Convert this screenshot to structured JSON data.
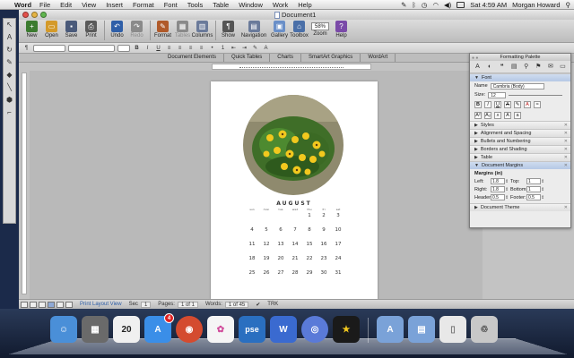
{
  "menubar": {
    "app": "Word",
    "items": [
      "File",
      "Edit",
      "View",
      "Insert",
      "Format",
      "Font",
      "Tools",
      "Table",
      "Window",
      "Work",
      "Help"
    ],
    "clock": "Sat 4:59 AM",
    "user": "Morgan Howard"
  },
  "window": {
    "title": "Document1"
  },
  "toolbar": {
    "buttons": [
      {
        "label": "New",
        "icon": "new-document-icon",
        "color": "#3b7b2f"
      },
      {
        "label": "Open",
        "icon": "open-folder-icon",
        "color": "#d49a2a"
      },
      {
        "label": "Save",
        "icon": "save-disk-icon",
        "color": "#4a5a7a"
      },
      {
        "label": "Print",
        "icon": "printer-icon",
        "color": "#5a5a5a"
      },
      {
        "label": "Undo",
        "icon": "undo-icon",
        "color": "#2f5fa8"
      },
      {
        "label": "Redo",
        "icon": "redo-icon",
        "color": "#8a8a8a"
      },
      {
        "label": "Format",
        "icon": "format-brush-icon",
        "color": "#b05a2a"
      },
      {
        "label": "Tables",
        "icon": "table-icon",
        "color": "#8a8a8a"
      },
      {
        "label": "Columns",
        "icon": "columns-icon",
        "color": "#6a7a9a"
      },
      {
        "label": "Show",
        "icon": "pilcrow-icon",
        "color": "#555555"
      },
      {
        "label": "Navigation",
        "icon": "navigation-pane-icon",
        "color": "#6a7a9a"
      },
      {
        "label": "Gallery",
        "icon": "gallery-icon",
        "color": "#6a8fc8"
      },
      {
        "label": "Toolbox",
        "icon": "toolbox-icon",
        "color": "#4a6fa8"
      },
      {
        "label": "Zoom",
        "icon": "zoom-field",
        "color": "#ffffff"
      },
      {
        "label": "Help",
        "icon": "help-icon",
        "color": "#7a4aa8"
      }
    ],
    "zoom": "58%"
  },
  "ribbon": {
    "tabs": [
      "Document Elements",
      "Quick Tables",
      "Charts",
      "SmartArt Graphics",
      "WordArt"
    ]
  },
  "document": {
    "month": "AUGUST",
    "weekday_headers": [
      "sun",
      "mon",
      "tue",
      "wed",
      "thu",
      "fri",
      "sat"
    ],
    "weeks": [
      [
        "",
        "",
        "",
        "",
        "1",
        "2",
        "3"
      ],
      [
        "4",
        "5",
        "6",
        "7",
        "8",
        "9",
        "10"
      ],
      [
        "11",
        "12",
        "13",
        "14",
        "15",
        "16",
        "17"
      ],
      [
        "18",
        "19",
        "20",
        "21",
        "22",
        "23",
        "24"
      ],
      [
        "25",
        "26",
        "27",
        "28",
        "29",
        "30",
        "31"
      ]
    ],
    "photo_description": "yellow flowers"
  },
  "status": {
    "view": "Print Layout View",
    "sec_label": "Sec",
    "sec": "1",
    "pages_label": "Pages:",
    "pages": "1 of 1",
    "words_label": "Words:",
    "words": "1 of 45",
    "trk": "TRK"
  },
  "palette": {
    "title": "Formatting Palette",
    "font_section": "Font",
    "name_label": "Name",
    "font_name": "Cambria (Body)",
    "size_label": "Size:",
    "font_size": "12",
    "styles": "Styles",
    "alignment": "Alignment and Spacing",
    "bullets": "Bullets and Numbering",
    "borders": "Borders and Shading",
    "table": "Table",
    "margins_section": "Document Margins",
    "margins_sub": "Margins (in)",
    "left_label": "Left:",
    "left": "1.8",
    "top_label": "Top:",
    "top": "1",
    "right_label": "Right:",
    "right": "1.8",
    "bottom_label": "Bottom:",
    "bottom": "1",
    "header_label": "Header:",
    "header": "0.5",
    "footer_label": "Footer:",
    "footer": "0.5",
    "theme": "Document Theme"
  },
  "dock": {
    "items": [
      {
        "name": "finder",
        "color": "#4a8fd8",
        "glyph": "☺"
      },
      {
        "name": "preview",
        "color": "#6a6a6a",
        "glyph": "▦"
      },
      {
        "name": "ical",
        "color": "#f0f0f0",
        "glyph": "20"
      },
      {
        "name": "app-store",
        "color": "#3a8ee8",
        "glyph": "A",
        "badge": "4"
      },
      {
        "name": "chrome",
        "color": "#d44b2f",
        "glyph": "◉"
      },
      {
        "name": "picasa",
        "color": "#f5f5f5",
        "glyph": "✿"
      },
      {
        "name": "photoshop-elements",
        "color": "#2a6fc0",
        "glyph": "pse"
      },
      {
        "name": "word-mark",
        "color": "#3a6ad0",
        "glyph": "W"
      },
      {
        "name": "itunes-radio",
        "color": "#5a7ad8",
        "glyph": "◎"
      },
      {
        "name": "imovie-star",
        "color": "#1a1a1a",
        "glyph": "★"
      }
    ],
    "right_items": [
      {
        "name": "applications-folder",
        "color": "#7aa2d8",
        "glyph": "A"
      },
      {
        "name": "documents-folder",
        "color": "#7aa2d8",
        "glyph": "▤"
      },
      {
        "name": "downloads-stack",
        "color": "#e8e8e8",
        "glyph": "▯"
      },
      {
        "name": "trash",
        "color": "#c8c8c8",
        "glyph": "🗑"
      }
    ]
  }
}
